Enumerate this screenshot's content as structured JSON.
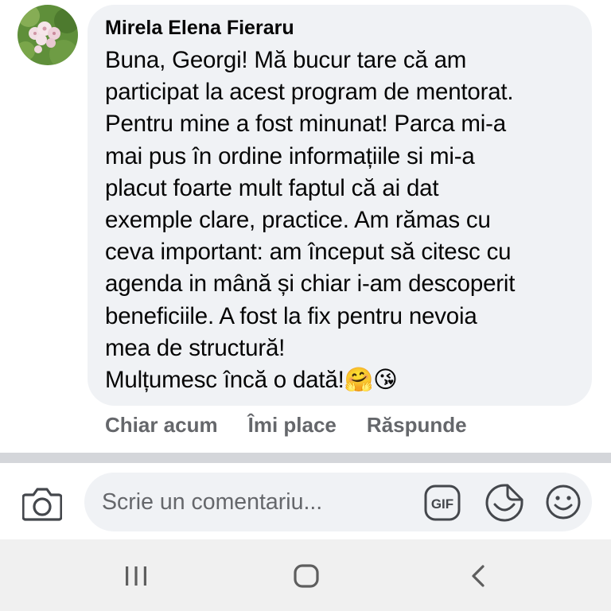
{
  "comment": {
    "author": "Mirela Elena Fieraru",
    "text": "Buna, Georgi! Mă bucur tare că am\nparticipat la acest program de mentorat.\nPentru mine a fost minunat! Parca mi-a\nmai pus în ordine informațiile si mi-a\nplacut foarte mult faptul că ai dat\nexemple clare, practice. Am rămas cu\nceva important: am început să citesc cu\nagenda in mână și chiar i-am descoperit\nbeneficiile. A fost la fix pentru nevoia\nmea de structură!\nMulțumesc încă o dată!",
    "emojis": "🤗😘",
    "time": "Chiar acum",
    "like_label": "Îmi place",
    "reply_label": "Răspunde"
  },
  "composer": {
    "placeholder": "Scrie un comentariu...",
    "icons": [
      "camera-icon",
      "gif-icon",
      "sticker-icon",
      "emoji-icon"
    ]
  },
  "navbar": {
    "icons": [
      "recent-apps-icon",
      "home-icon",
      "back-icon"
    ]
  },
  "colors": {
    "bubble_bg": "#f0f2f5",
    "secondary_text": "#65676b",
    "divider": "#d4d6da",
    "navbar_bg": "#f0f0f0"
  }
}
